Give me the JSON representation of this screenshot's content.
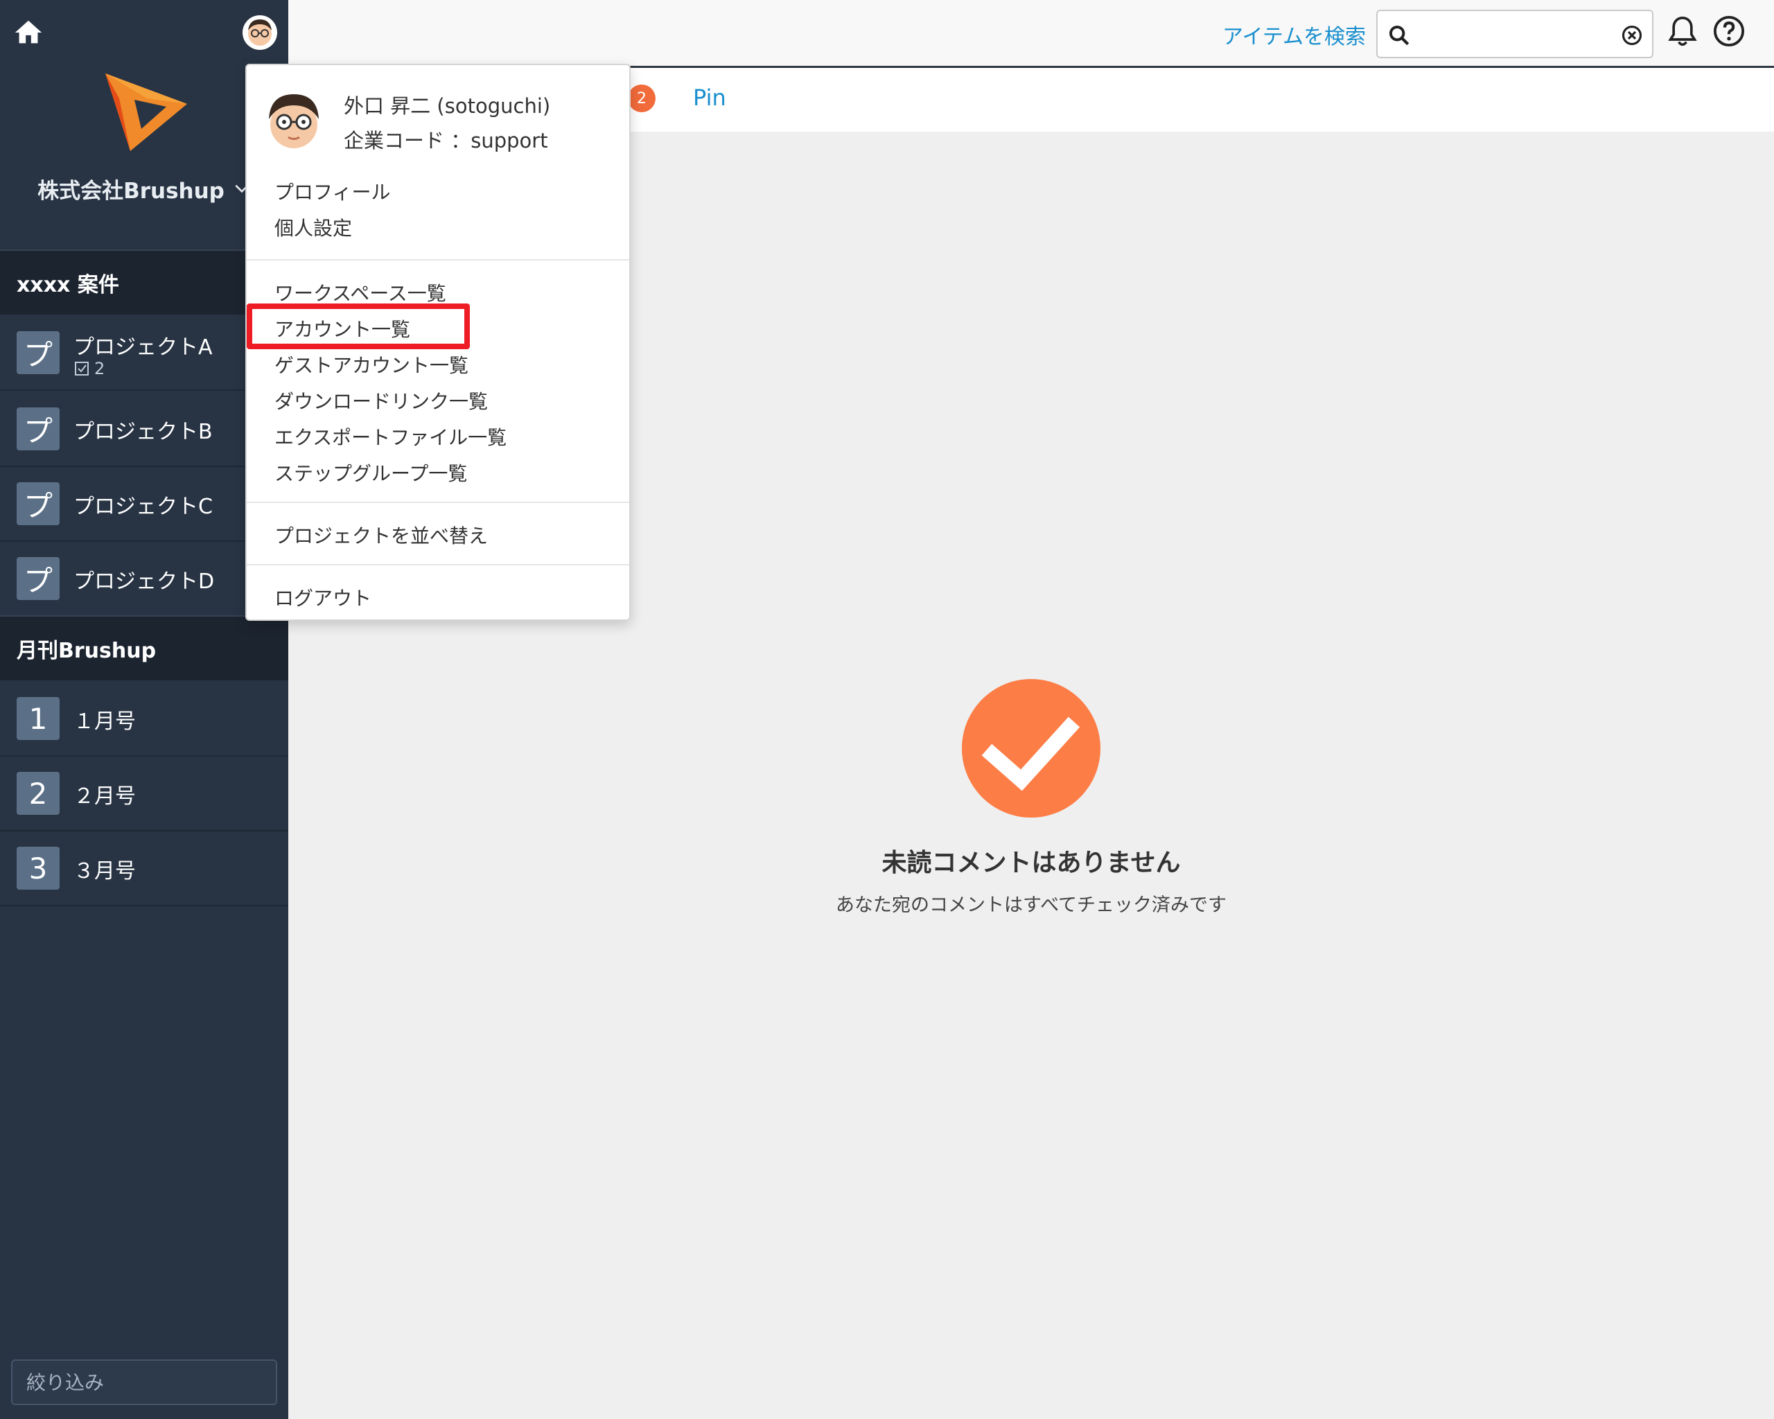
{
  "sidebar": {
    "company_name": "株式会社Brushup",
    "groups": [
      {
        "title": "xxxx 案件",
        "items": [
          {
            "badge": "プ",
            "label": "プロジェクトA",
            "sub_count": "2"
          },
          {
            "badge": "プ",
            "label": "プロジェクトB"
          },
          {
            "badge": "プ",
            "label": "プロジェクトC"
          },
          {
            "badge": "プ",
            "label": "プロジェクトD"
          }
        ]
      },
      {
        "title": "月刊Brushup",
        "items": [
          {
            "badge": "1",
            "label": "１月号"
          },
          {
            "badge": "2",
            "label": "２月号"
          },
          {
            "badge": "3",
            "label": "３月号"
          }
        ]
      }
    ],
    "filter_placeholder": "絞り込み"
  },
  "topbar": {
    "search_link": "アイテムを検索",
    "search_value": ""
  },
  "tabs": {
    "count": "2",
    "pin_label": "Pin"
  },
  "empty_state": {
    "title": "未読コメントはありません",
    "subtitle": "あなた宛のコメントはすべてチェック済みです"
  },
  "user_menu": {
    "user_name": "外口 昇二 (sotoguchi)",
    "company_code": "企業コード ：support",
    "items": {
      "profile": "プロフィール",
      "personal_settings": "個人設定",
      "workspace_list": "ワークスペース一覧",
      "account_list": "アカウント一覧",
      "guest_account_list": "ゲストアカウント一覧",
      "download_link_list": "ダウンロードリンク一覧",
      "export_file_list": "エクスポートファイル一覧",
      "step_group_list": "ステップグループ一覧",
      "sort_projects": "プロジェクトを並べ替え",
      "logout": "ログアウト"
    }
  },
  "colors": {
    "sidebar_bg": "#283444",
    "sidebar_header_bg": "#1c2430",
    "accent_blue": "#1a8fce",
    "brand_orange": "#f26b3a",
    "highlight_red": "#ee1c25"
  },
  "icons": [
    "home-icon",
    "avatar",
    "brand-logo",
    "chevron-down-icon",
    "checklist-icon",
    "search-icon",
    "clear-icon",
    "bell-icon",
    "help-icon",
    "check-circle-icon"
  ]
}
